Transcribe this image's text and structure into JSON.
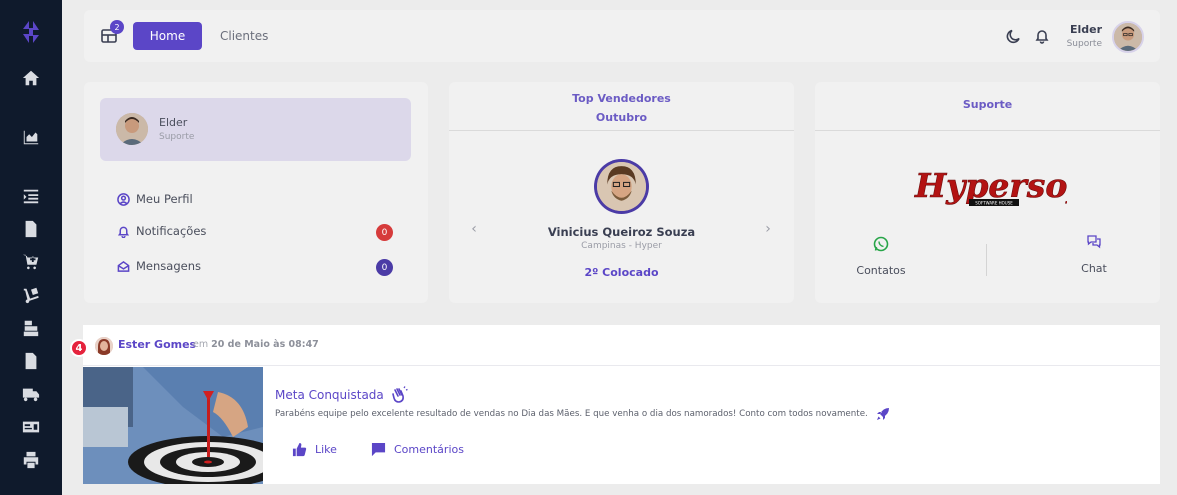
{
  "topbar": {
    "apps_badge": "2",
    "nav": [
      {
        "label": "Home"
      },
      {
        "label": "Clientes"
      }
    ],
    "user_name": "Elder",
    "user_role": "Suporte"
  },
  "profile_card": {
    "name": "Elder",
    "role": "Suporte",
    "menu": [
      {
        "label": "Meu Perfil",
        "icon": "user-circle-icon"
      },
      {
        "label": "Notificações",
        "icon": "bell-icon",
        "count": "0",
        "count_color": "#d63b3b"
      },
      {
        "label": "Mensagens",
        "icon": "envelope-icon",
        "count": "0",
        "count_color": "#4b3ba6"
      }
    ]
  },
  "top_sellers": {
    "title": "Top Vendedores",
    "month": "Outubro",
    "seller_name": "Vinicius Queiroz Souza",
    "seller_city": "Campinas - Hyper",
    "seller_rank": "2º Colocado"
  },
  "support_card": {
    "title": "Suporte",
    "logo_text": "Hypersoft",
    "logo_subtext": "SOFTWARE HOUSE",
    "contacts_label": "Contatos",
    "chat_label": "Chat"
  },
  "post": {
    "step_badge": "4",
    "author": "Ester Gomes",
    "meta_prefix": "em",
    "meta_date": "20 de Maio às 08:47",
    "title": "Meta Conquistada",
    "text": "Parabéns equipe pelo excelente resultado de vendas no Dia das Mães. E que venha o dia dos namorados! Conto com todos novamente.",
    "like_label": "Like",
    "comments_label": "Comentários"
  },
  "colors": {
    "accent": "#5b46c7",
    "sidebar": "#0f1a2c",
    "danger": "#e5233d"
  }
}
